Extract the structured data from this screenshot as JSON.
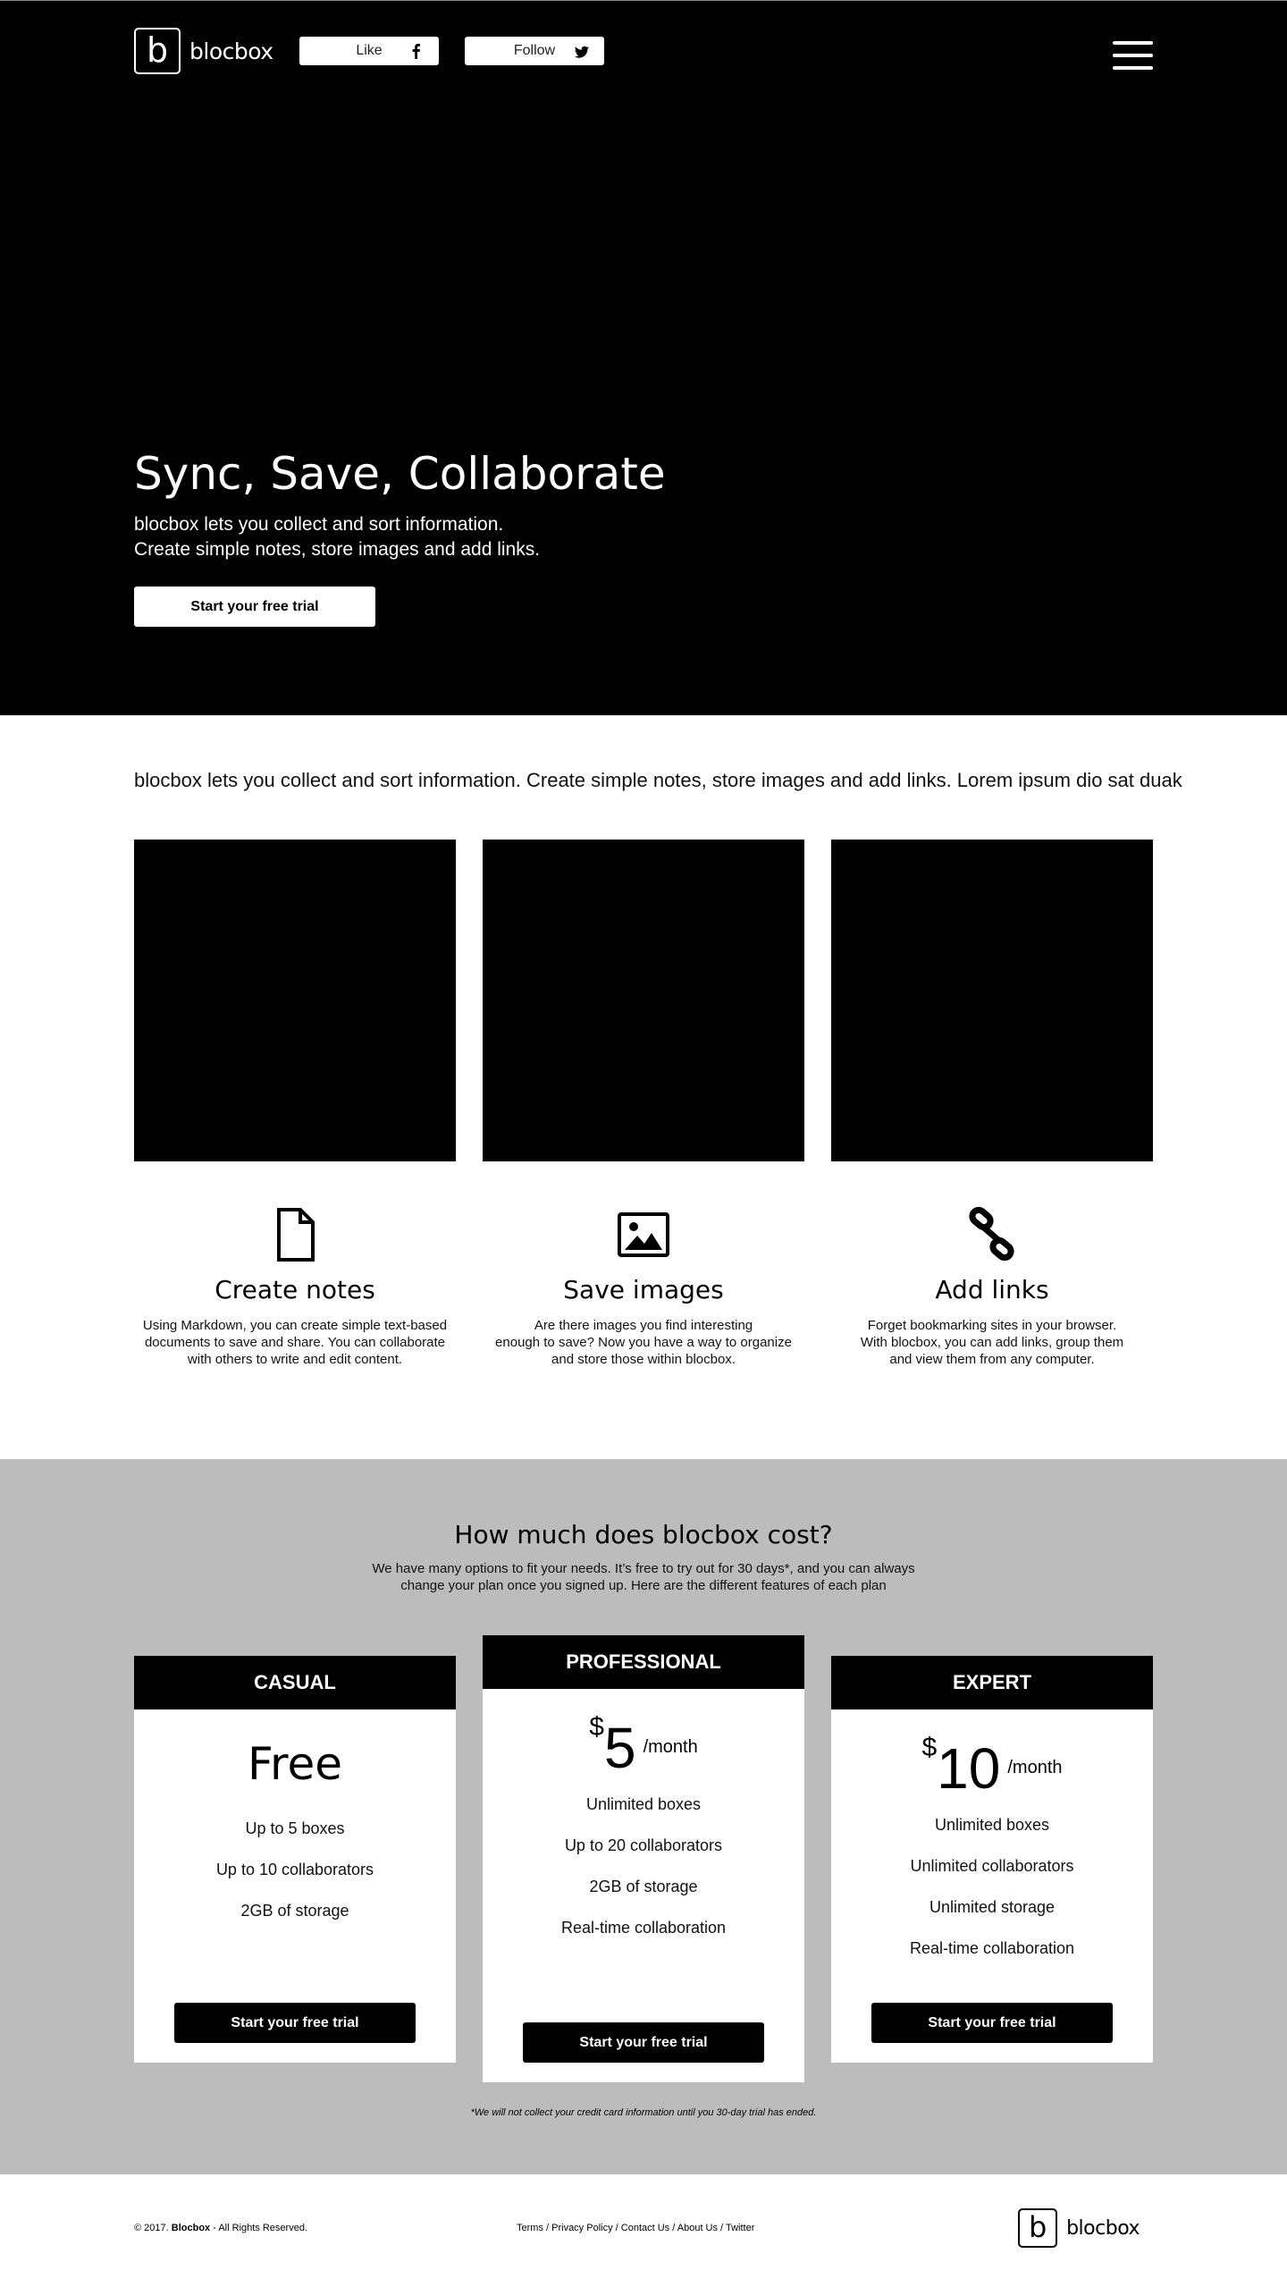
{
  "header": {
    "logo_letter": "b",
    "logo_text": "blocbox",
    "like_label": "Like",
    "follow_label": "Follow"
  },
  "hero": {
    "title": "Sync, Save, Collaborate",
    "subtitle_line1": "blocbox lets you collect and sort information.",
    "subtitle_line2": "Create simple notes, store images and add links.",
    "cta": "Start your free trial"
  },
  "intro": {
    "text": "blocbox lets you collect and sort information. Create simple notes, store images and add links. Lorem ipsum dio sat duak"
  },
  "features": [
    {
      "icon": "document-icon",
      "title": "Create notes",
      "line1": "Using Markdown, you can create simple text-based",
      "line2": "documents to save and share. You can collaborate",
      "line3": "with others to write and edit content."
    },
    {
      "icon": "image-icon",
      "title": "Save images",
      "line1": "Are there images you find interesting",
      "line2": "enough to save? Now you have a way to organize",
      "line3": "and store those within blocbox."
    },
    {
      "icon": "link-icon",
      "title": "Add links",
      "line1": "Forget bookmarking sites in your browser.",
      "line2": "With blocbox, you can add links, group them",
      "line3": "and view them from any computer."
    }
  ],
  "pricing": {
    "title": "How much does blocbox cost?",
    "sub_line1": "We have many options to fit your needs. It’s free to try out for 30 days*, and you can always",
    "sub_line2": "change your plan once you signed up. Here are the different features of each plan",
    "plans": [
      {
        "name": "CASUAL",
        "price": "Free",
        "features": [
          "Up to 5 boxes",
          "Up to 10 collaborators",
          "2GB of storage"
        ],
        "cta": "Start your free trial"
      },
      {
        "name": "PROFESSIONAL",
        "currency": "$",
        "amount": "5",
        "period": "/month",
        "features": [
          "Unlimited boxes",
          "Up to 20 collaborators",
          "2GB of storage",
          "Real-time collaboration"
        ],
        "cta": "Start your free trial"
      },
      {
        "name": "EXPERT",
        "currency": "$",
        "amount": "10",
        "period": "/month",
        "features": [
          "Unlimited boxes",
          "Unlimited collaborators",
          "Unlimited storage",
          "Real-time collaboration"
        ],
        "cta": "Start your free trial"
      }
    ],
    "footnote": "*We will not collect your credit card information until you 30-day trial has ended."
  },
  "footer": {
    "copyright_prefix": "© 2017.",
    "copyright_brand": "Blocbox",
    "copyright_suffix": "- All Rights Reserved.",
    "links": [
      "Terms",
      "Privacy Policy",
      "Contact Us",
      "About Us",
      "Twitter"
    ],
    "logo_letter": "b",
    "logo_text": "blocbox"
  },
  "colors": {
    "hero_bg": "#000000",
    "pricing_bg": "#bcbcbc",
    "card_header_bg": "#000000",
    "button_bg_dark": "#000000",
    "button_bg_light": "#ffffff"
  }
}
